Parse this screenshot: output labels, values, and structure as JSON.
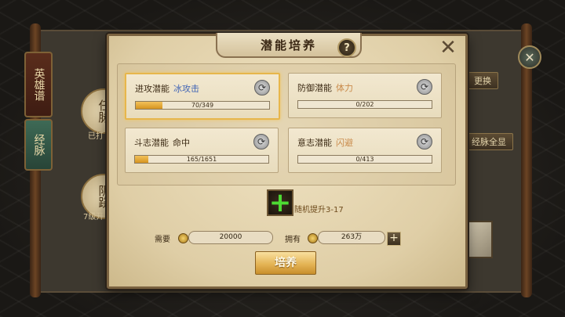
{
  "background": {
    "side_tabs": [
      {
        "label": "英雄谱"
      },
      {
        "label": "经脉"
      }
    ],
    "circles": [
      {
        "label": "任脉"
      },
      {
        "label": "阴跷"
      }
    ],
    "status_text": "已打",
    "level_text": "7级开",
    "swap_label": "更换",
    "unlock_label": "经脉全显"
  },
  "modal": {
    "title": "潜能培养",
    "help_glyph": "?",
    "close_glyph": "✕",
    "cards": [
      {
        "title": "进攻潜能",
        "sub": "冰攻击",
        "sub_style": "blue",
        "current": 70,
        "max": 349,
        "progress_text": "70/349",
        "selected": true
      },
      {
        "title": "防御潜能",
        "sub": "体力",
        "sub_style": "muted",
        "current": 0,
        "max": 202,
        "progress_text": "0/202",
        "selected": false
      },
      {
        "title": "斗志潜能",
        "sub": "命中",
        "sub_style": "dark",
        "current": 165,
        "max": 1651,
        "progress_text": "165/1651",
        "selected": false
      },
      {
        "title": "意志潜能",
        "sub": "闪避",
        "sub_style": "muted",
        "current": 0,
        "max": 413,
        "progress_text": "0/413",
        "selected": false
      }
    ],
    "random_boost": "随机提升3-17",
    "cost": {
      "label": "需要",
      "value": "20000"
    },
    "owned": {
      "label": "拥有",
      "value": "263万"
    },
    "add_glyph": "+",
    "cultivate_button": "培养"
  },
  "colors": {
    "accent": "#e7b64b",
    "progress": "#e3a534",
    "sub_blue": "#3f63b5",
    "plus_green": "#4ddb33"
  }
}
